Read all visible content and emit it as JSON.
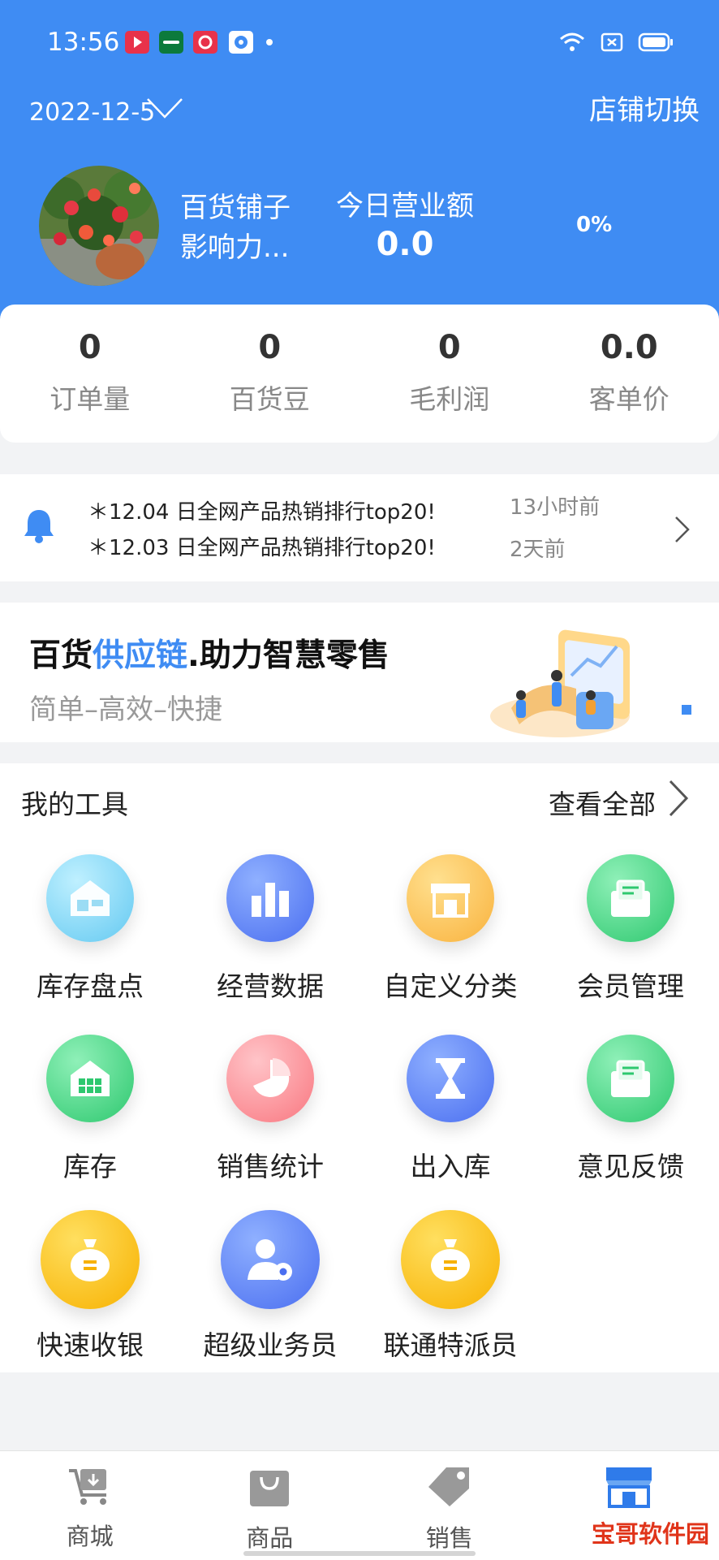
{
  "status_bar": {
    "time": "13:56"
  },
  "header": {
    "date": "2022-12-5",
    "switch_store": "店铺切换",
    "store_name": "百货铺子",
    "influence": "影响力...",
    "revenue_label": "今日营业额",
    "revenue_value": "0.0",
    "revenue_pct": "0%"
  },
  "stats": [
    {
      "value": "0",
      "label": "订单量"
    },
    {
      "value": "0",
      "label": "百货豆"
    },
    {
      "value": "0",
      "label": "毛利润"
    },
    {
      "value": "0.0",
      "label": "客单价"
    }
  ],
  "notices": [
    {
      "text": "＊12.04 日全网产品热销排行top20!",
      "time": "13小时前"
    },
    {
      "text": "＊12.03 日全网产品热销排行top20!",
      "time": "2天前"
    }
  ],
  "banner": {
    "title_a": "百货",
    "title_b": "供应链",
    "title_c": ".助力智慧零售",
    "subtitle": "简单–高效–快捷"
  },
  "tools": {
    "title": "我的工具",
    "view_all": "查看全部",
    "items": [
      {
        "label": "库存盘点",
        "icon": "warehouse-icon"
      },
      {
        "label": "经营数据",
        "icon": "bar-chart-icon"
      },
      {
        "label": "自定义分类",
        "icon": "storefront-icon"
      },
      {
        "label": "会员管理",
        "icon": "envelope-icon"
      },
      {
        "label": "库存",
        "icon": "house-icon"
      },
      {
        "label": "销售统计",
        "icon": "pie-chart-icon"
      },
      {
        "label": "出入库",
        "icon": "hourglass-icon"
      },
      {
        "label": "意见反馈",
        "icon": "envelope-icon"
      },
      {
        "label": "快速收银",
        "icon": "money-bag-icon"
      },
      {
        "label": "超级业务员",
        "icon": "user-gear-icon"
      },
      {
        "label": "联通特派员",
        "icon": "money-bag-icon"
      }
    ]
  },
  "tabbar": [
    {
      "label": "商城",
      "icon": "cart-icon"
    },
    {
      "label": "商品",
      "icon": "shopping-bag-icon"
    },
    {
      "label": "销售",
      "icon": "price-tag-icon"
    },
    {
      "label": "",
      "icon": "store-icon"
    }
  ],
  "watermark": "宝哥软件园",
  "colors": {
    "primary": "#3f8cf3",
    "active_tab": "#2f7bea"
  }
}
